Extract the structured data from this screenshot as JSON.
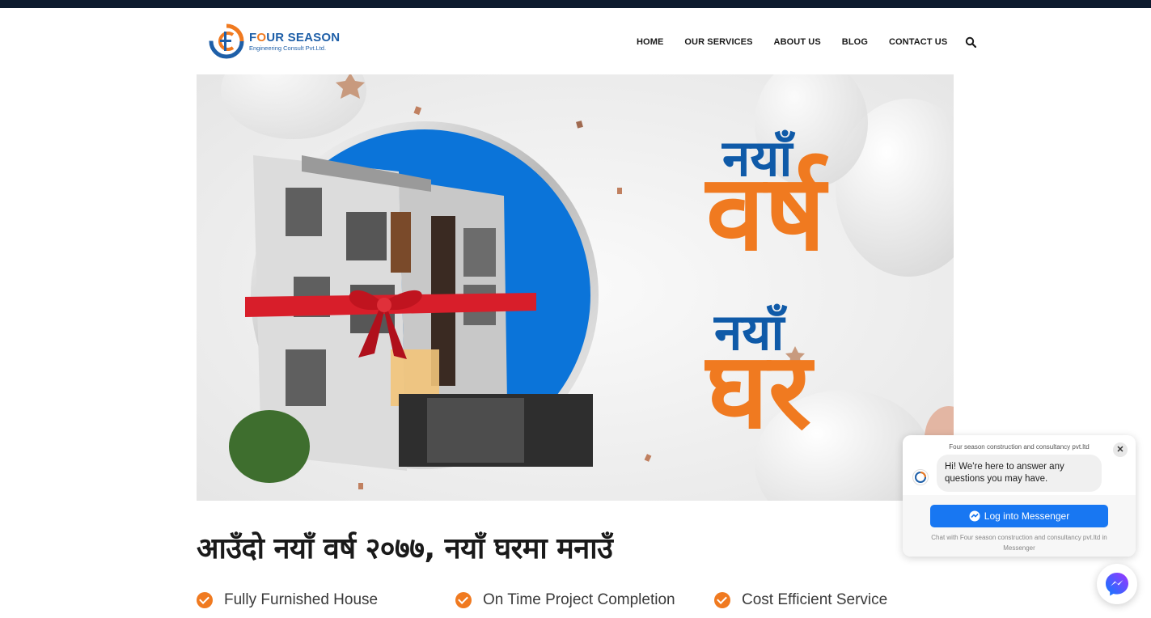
{
  "brand": {
    "name_part1": "F",
    "name_o": "O",
    "name_part2": "UR SEASON",
    "subtitle": "Engineering Consult Pvt.Ltd."
  },
  "nav": {
    "items": [
      "HOME",
      "OUR SERVICES",
      "ABOUT US",
      "BLOG",
      "CONTACT US"
    ],
    "search_icon": "search-icon"
  },
  "hero": {
    "line1": "नयाँ",
    "line2": "वर्ष",
    "line3": "नयाँ",
    "line4": "घर",
    "colors": {
      "blue": "#0f5aa8",
      "orange": "#f07a20",
      "circle": "#0b74d9"
    }
  },
  "headline": "आउँदो नयाँ वर्ष २०७७, नयाँ घरमा मनाउँ",
  "features": [
    "Fully Furnished House",
    "On Time Project Completion",
    "Cost Efficient Service"
  ],
  "chat": {
    "page_name": "Four season construction and consultancy pvt.ltd",
    "close": "✕",
    "message": "Hi! We're here to answer any questions you may have.",
    "button": "Log into Messenger",
    "note": "Chat with Four season construction and consultancy pvt.ltd in Messenger"
  },
  "accent": "#f07a20",
  "brand_blue": "#1e5fa8"
}
